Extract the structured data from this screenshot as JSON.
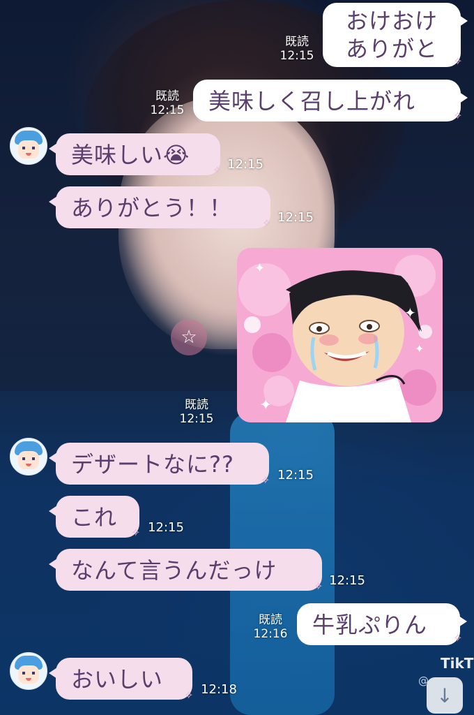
{
  "messages": [
    {
      "side": "right",
      "text": "おけおけ\nありがと",
      "read": "既読",
      "time": "12:15"
    },
    {
      "side": "right",
      "text": "美味しく召し上がれ",
      "read": "既読",
      "time": "12:15"
    },
    {
      "side": "left",
      "text": "美味しい😭",
      "time": "12:15"
    },
    {
      "side": "left",
      "text": "ありがとう！！",
      "time": "12:15"
    },
    {
      "side": "right",
      "type": "sticker",
      "read": "既読",
      "time": "12:15"
    },
    {
      "side": "left",
      "text": "デザートなに??",
      "time": "12:15"
    },
    {
      "side": "left",
      "text": "これ",
      "time": "12:15"
    },
    {
      "side": "left",
      "text": "なんて言うんだっけ",
      "time": "12:15"
    },
    {
      "side": "right",
      "text": "牛乳ぷりん",
      "read": "既読",
      "time": "12:16"
    },
    {
      "side": "left",
      "text": "おいしい",
      "time": "12:18"
    }
  ],
  "overlay": {
    "tiktok": "TikT",
    "tiktok_user": "@",
    "scroll_icon": "↓",
    "star_icon": "☆"
  },
  "colors": {
    "left_bubble": "#f5ddec",
    "right_bubble": "#ffffff",
    "text": "#5a3e6b",
    "sticker_bg": "#f6a9d3"
  }
}
